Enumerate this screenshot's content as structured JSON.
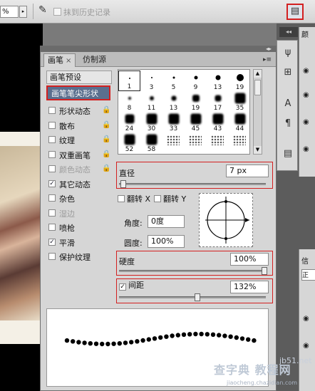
{
  "optbar": {
    "percent": "%",
    "history_checkbox_label": "抹到历史记录"
  },
  "panel": {
    "tabs": [
      {
        "label": "画笔",
        "close": "×"
      },
      {
        "label": "仿制源"
      }
    ],
    "list_header": "画笔预设",
    "selected_item": "画笔笔尖形状",
    "items": [
      {
        "label": "形状动态",
        "checked": false,
        "dim": false
      },
      {
        "label": "散布",
        "checked": false,
        "dim": false
      },
      {
        "label": "纹理",
        "checked": false,
        "dim": false
      },
      {
        "label": "双重画笔",
        "checked": false,
        "dim": false
      },
      {
        "label": "颜色动态",
        "checked": false,
        "dim": true
      },
      {
        "label": "其它动态",
        "checked": true,
        "dim": false
      },
      {
        "label": "杂色",
        "checked": false,
        "dim": false
      },
      {
        "label": "湿边",
        "checked": false,
        "dim": true
      },
      {
        "label": "喷枪",
        "checked": false,
        "dim": false
      },
      {
        "label": "平滑",
        "checked": true,
        "dim": false
      },
      {
        "label": "保护纹理",
        "checked": false,
        "dim": false
      }
    ],
    "tips_row1": [
      "1",
      "3",
      "5",
      "9",
      "13",
      "19"
    ],
    "tips_row2": [
      "8",
      "11",
      "13",
      "19",
      "17",
      "35"
    ],
    "tips_row3": [
      "24",
      "30",
      "33",
      "45",
      "43",
      "44"
    ],
    "tips_row4": [
      "52",
      "58",
      "",
      "",
      "",
      ""
    ],
    "diameter_label": "直径",
    "diameter_value": "7 px",
    "diameter_fraction": 0.01,
    "flip_x": "翻转 X",
    "flip_y": "翻转 Y",
    "angle_label": "角度:",
    "angle_value": "0度",
    "roundness_label": "圆度:",
    "roundness_value": "100%",
    "hardness_label": "硬度",
    "hardness_value": "100%",
    "hardness_fraction": 1.0,
    "spacing_label": "间距",
    "spacing_value": "132%",
    "spacing_checked": true,
    "spacing_fraction": 0.53
  },
  "watermark": {
    "site": "jb51.net",
    "line1": "查字典 教程网",
    "line2": "jiaocheng.chazidian.com"
  }
}
